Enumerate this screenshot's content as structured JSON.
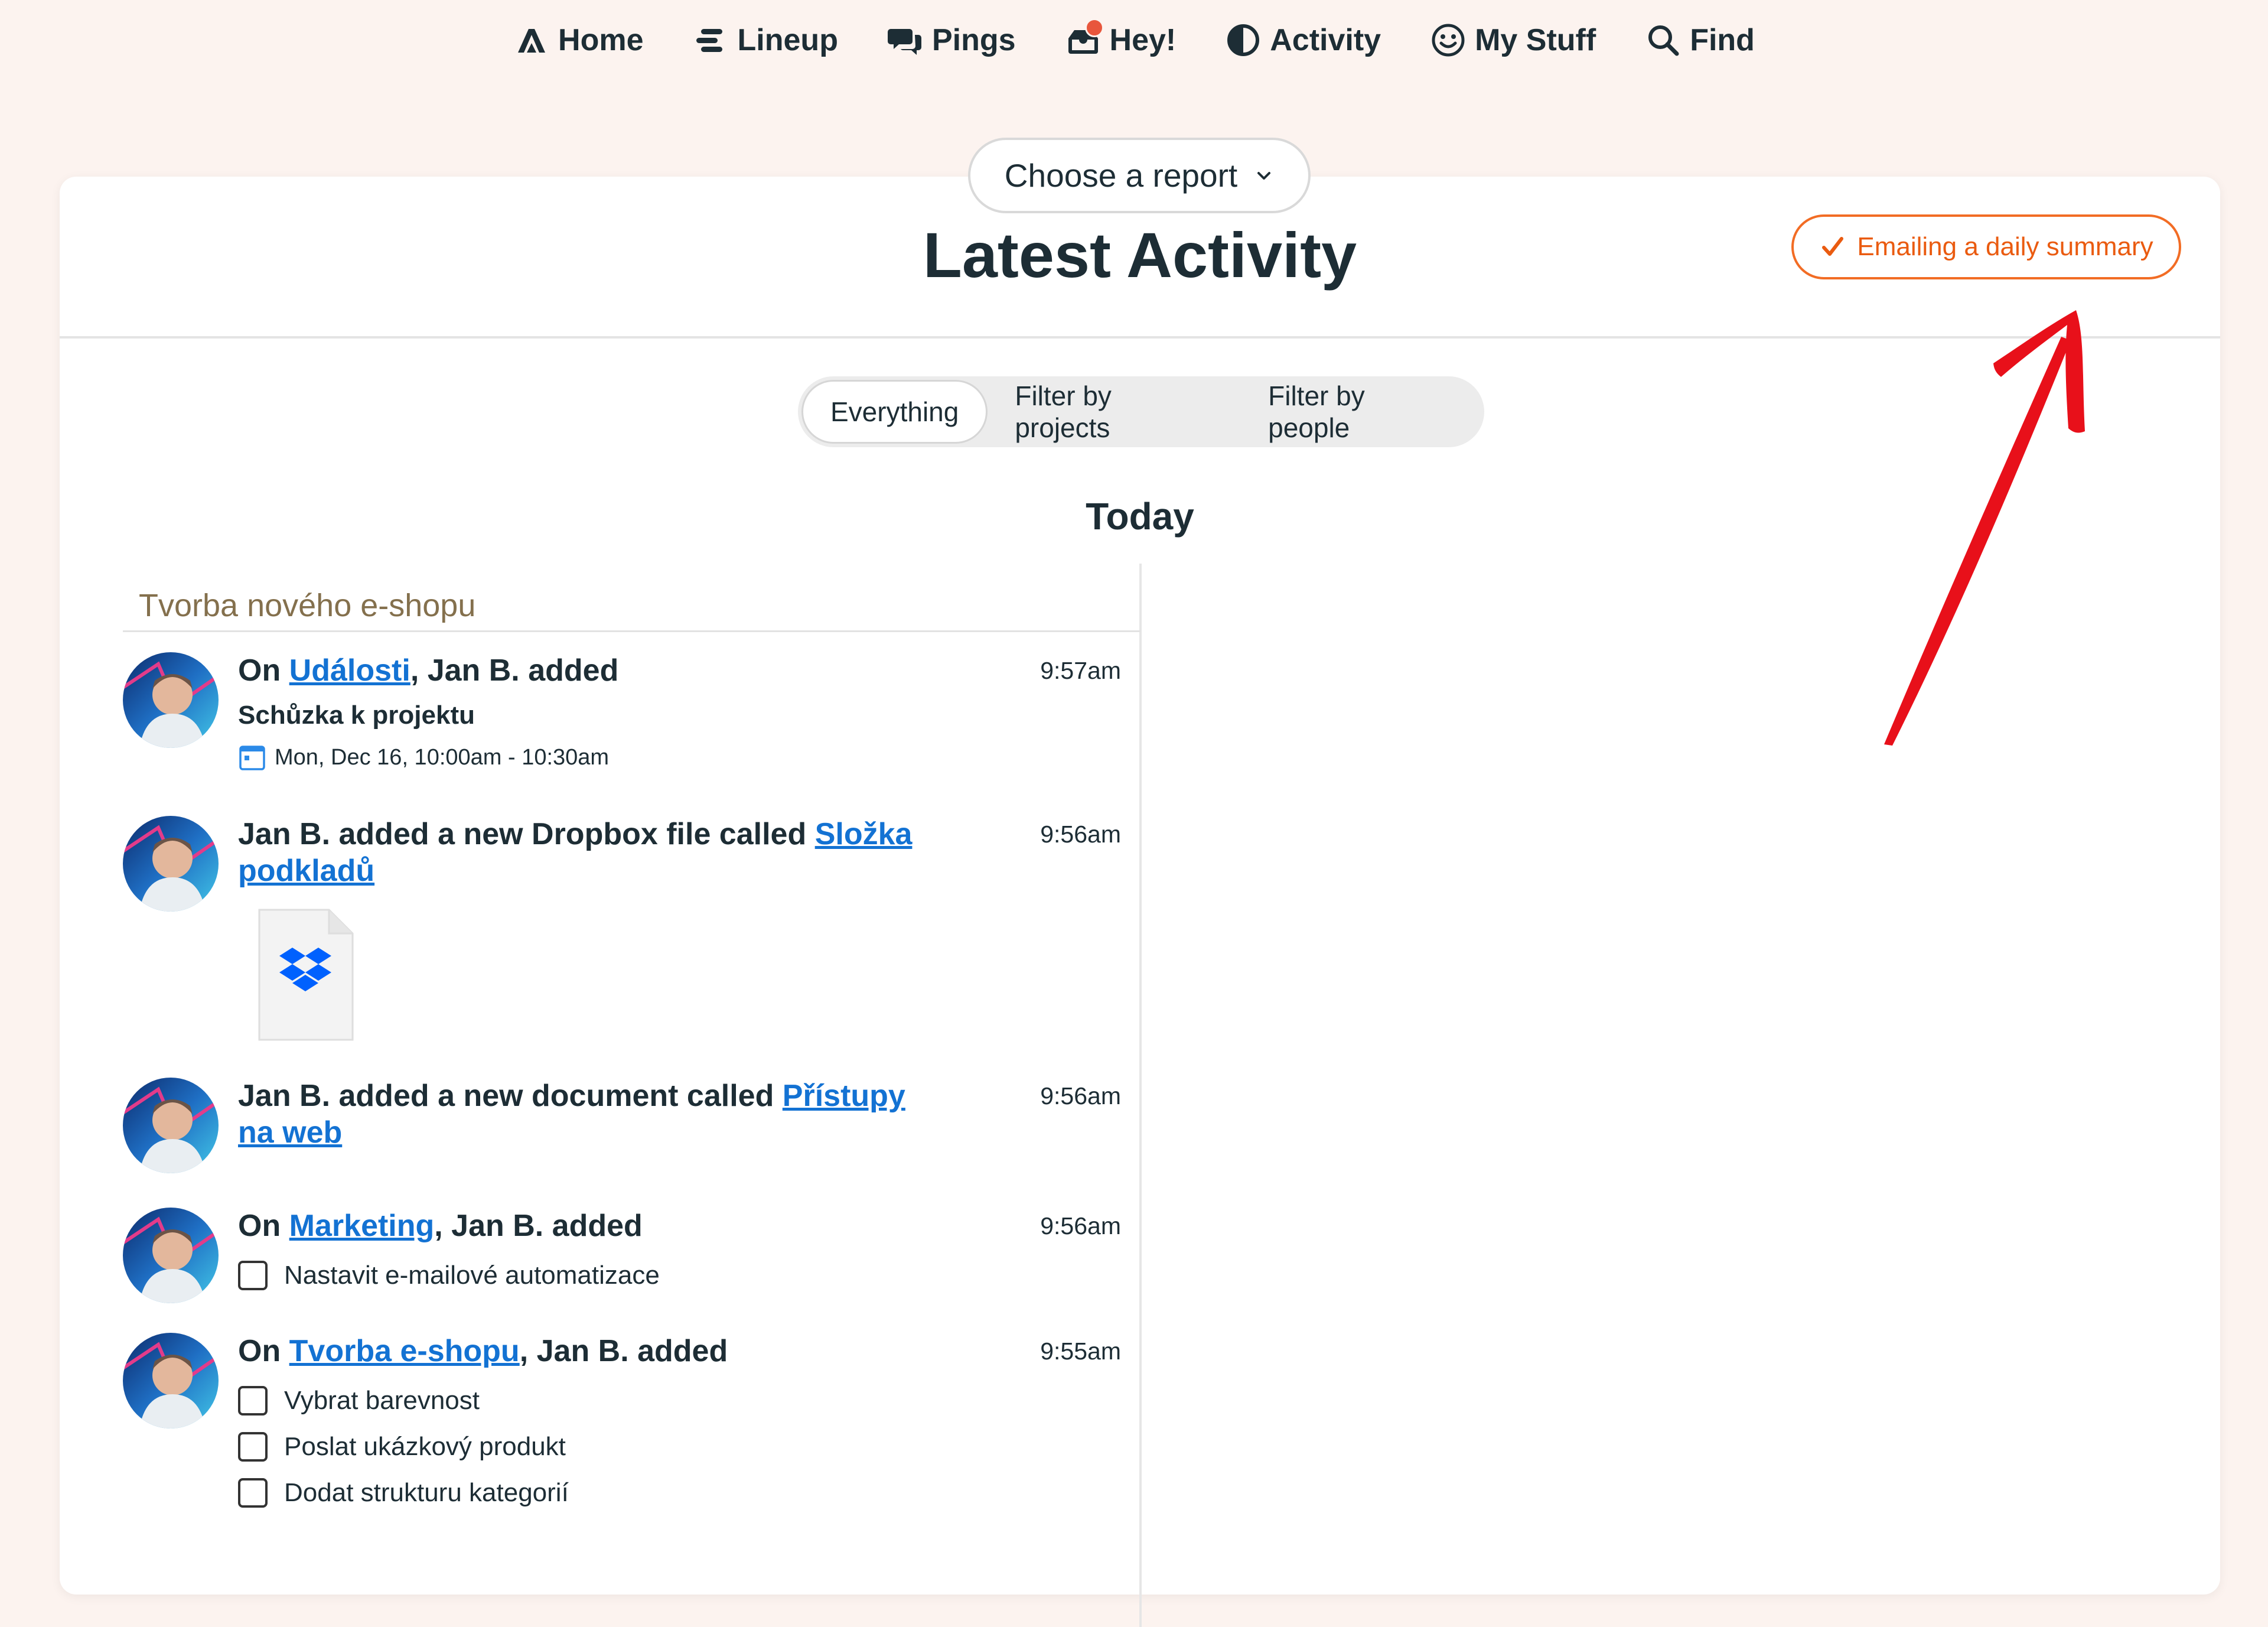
{
  "nav": {
    "items": [
      {
        "label": "Home",
        "icon": "home-icon"
      },
      {
        "label": "Lineup",
        "icon": "lineup-icon"
      },
      {
        "label": "Pings",
        "icon": "pings-icon"
      },
      {
        "label": "Hey!",
        "icon": "hey-icon"
      },
      {
        "label": "Activity",
        "icon": "activity-icon"
      },
      {
        "label": "My Stuff",
        "icon": "smiley-icon"
      },
      {
        "label": "Find",
        "icon": "search-icon"
      }
    ]
  },
  "header": {
    "report_chooser": "Choose a report",
    "title": "Latest Activity",
    "email_summary": "Emailing a daily summary"
  },
  "filters": [
    "Everything",
    "Filter by projects",
    "Filter by people"
  ],
  "day": "Today",
  "project": "Tvorba nového e-shopu",
  "entries": {
    "e1": {
      "prefix": "On ",
      "link": "Události",
      "suffix": ", Jan B. added",
      "time": "9:57am",
      "event_title": "Schůzka k projektu",
      "event_date": "Mon, Dec 16, 10:00am - 10:30am"
    },
    "e2": {
      "prefix": "Jan B. added a new Dropbox file called ",
      "link": "Složka podkladů",
      "time": "9:56am"
    },
    "e3": {
      "prefix": "Jan B. added a new document called ",
      "link": "Přístupy na web",
      "time": "9:56am"
    },
    "e4": {
      "prefix": "On ",
      "link": "Marketing",
      "suffix": ", Jan B. added",
      "time": "9:56am",
      "todos": [
        "Nastavit e-mailové automatizace"
      ]
    },
    "e5": {
      "prefix": "On ",
      "link": "Tvorba e-shopu",
      "suffix": ", Jan B. added",
      "time": "9:55am",
      "todos": [
        "Vybrat barevnost",
        "Poslat ukázkový produkt",
        "Dodat strukturu kategorií"
      ]
    }
  },
  "colors": {
    "background": "#fcf3ef",
    "accent": "#f26c24",
    "link": "#1372d3",
    "project_label": "#84704d",
    "annotation_arrow": "#e8101a",
    "notification_dot": "#e8563c"
  }
}
